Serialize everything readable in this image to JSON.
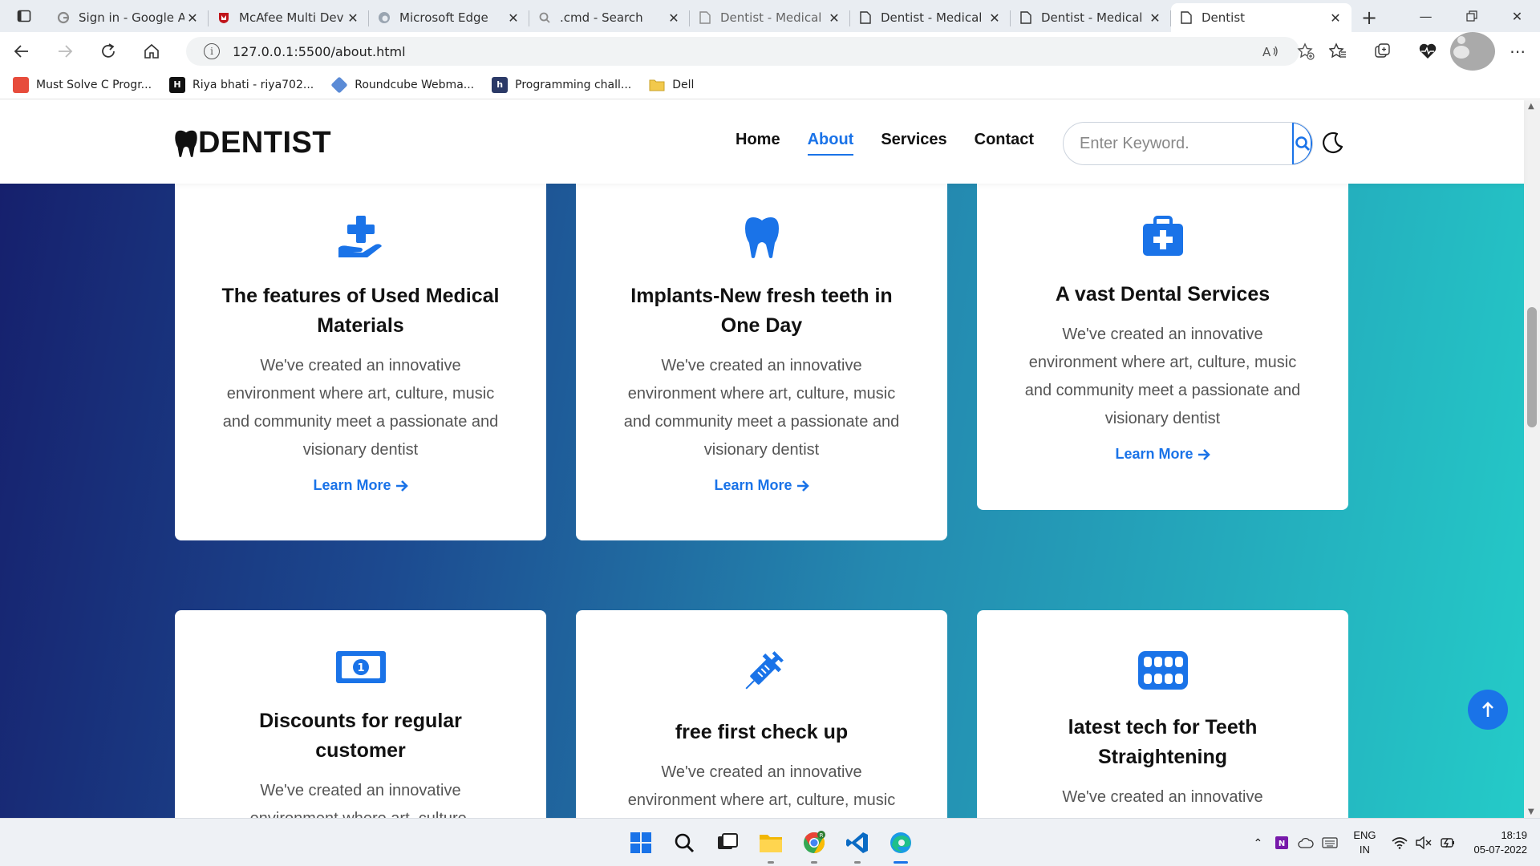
{
  "browser": {
    "tabs": [
      {
        "title": "Sign in - Google A",
        "icon": "google-icon"
      },
      {
        "title": "McAfee Multi Dev",
        "icon": "mcafee-icon"
      },
      {
        "title": "Microsoft Edge",
        "icon": "edge-icon"
      },
      {
        "title": ".cmd - Search",
        "icon": "search-icon"
      },
      {
        "title": "Dentist - Medical",
        "icon": "page-icon"
      },
      {
        "title": "Dentist - Medical",
        "icon": "page-icon"
      },
      {
        "title": "Dentist - Medical",
        "icon": "page-icon"
      },
      {
        "title": "Dentist",
        "icon": "page-icon",
        "active": true
      }
    ],
    "url": "127.0.0.1:5500/about.html",
    "bookmarks": [
      {
        "label": "Must Solve C Progr...",
        "color": "#e74c3c"
      },
      {
        "label": "Riya bhati - riya702...",
        "color": "#111111"
      },
      {
        "label": "Roundcube Webma...",
        "color": "#5b8bd6"
      },
      {
        "label": "Programming chall...",
        "color": "#2b3a67"
      },
      {
        "label": "Dell",
        "color": "#f2c94c"
      }
    ]
  },
  "site": {
    "logo": "DENTIST",
    "nav": [
      "Home",
      "About",
      "Services",
      "Contact"
    ],
    "active_nav": "About",
    "search_placeholder": "Enter Keyword.",
    "accent": "#1a73e8",
    "cards": [
      {
        "icon": "hand-medical-icon",
        "title": "The features of Used Medical Materials",
        "text": "We've created an innovative environment where art, culture, music and community meet a passionate and visionary dentist",
        "link": "Learn More"
      },
      {
        "icon": "tooth-icon",
        "title": "Implants-New fresh teeth in One Day",
        "text": "We've created an innovative environment where art, culture, music and community meet a passionate and visionary dentist",
        "link": "Learn More"
      },
      {
        "icon": "medical-kit-icon",
        "title": "A vast Dental Services",
        "text": "We've created an innovative environment where art, culture, music and community meet a passionate and visionary dentist",
        "link": "Learn More"
      },
      {
        "icon": "money-bill-icon",
        "title": "Discounts for regular customer",
        "text": "We've created an innovative environment where art, culture,",
        "link": ""
      },
      {
        "icon": "syringe-icon",
        "title": "free first check up",
        "text": "We've created an innovative environment where art, culture, music and community meet a",
        "link": ""
      },
      {
        "icon": "teeth-icon",
        "title": "latest tech for Teeth Straightening",
        "text": "We've created an innovative environment where art, culture,",
        "link": ""
      }
    ]
  },
  "taskbar": {
    "lang": "ENG",
    "region": "IN",
    "time": "18:19",
    "date": "05-07-2022"
  }
}
